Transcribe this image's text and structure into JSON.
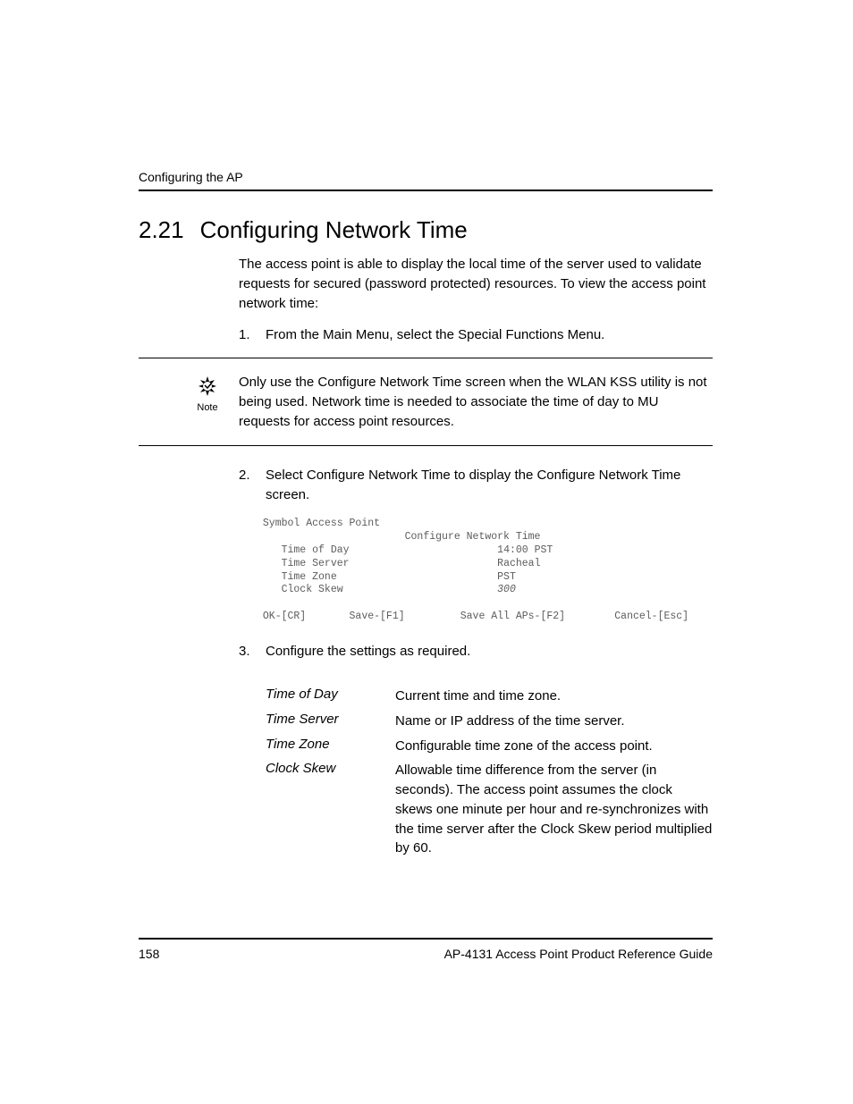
{
  "header": {
    "running_head": "Configuring the AP"
  },
  "section": {
    "number": "2.21",
    "title": "Configuring Network Time",
    "intro": "The access point is able to display the local time of the server used to validate requests for secured (password protected) resources. To view the access point network time:"
  },
  "steps": {
    "s1_marker": "1.",
    "s1_text": "From the Main Menu, select the Special Functions Menu.",
    "s2_marker": "2.",
    "s2_text": "Select Configure Network Time to display the Configure Network Time screen.",
    "s3_marker": "3.",
    "s3_text": "Configure the settings as required."
  },
  "note": {
    "label": "Note",
    "text": "Only use the Configure Network Time screen when the WLAN KSS utility is not being used. Network time is needed to associate the time of day to MU requests for access point resources."
  },
  "terminal": {
    "line1": " Symbol Access Point",
    "line2": "                        Configure Network Time",
    "line3_label": "    Time of Day",
    "line3_value": "14:00 PST",
    "line4_label": "    Time Server",
    "line4_value": "Racheal",
    "line5_label": "    Time Zone",
    "line5_value": "PST",
    "line6_label": "    Clock Skew",
    "line6_value": "300",
    "footer": " OK-[CR]       Save-[F1]         Save All APs-[F2]        Cancel-[Esc]"
  },
  "settings": {
    "time_of_day": {
      "label": "Time of Day",
      "desc": "Current time and time zone."
    },
    "time_server": {
      "label": "Time Server",
      "desc": "Name or IP address of the time server."
    },
    "time_zone": {
      "label": "Time Zone",
      "desc": "Configurable time zone of the access point."
    },
    "clock_skew": {
      "label": "Clock Skew",
      "desc": "Allowable time difference from the server (in seconds). The access point assumes the clock skews one minute per hour and re-synchronizes with the time server after the Clock Skew period multiplied by 60."
    }
  },
  "footer": {
    "page_num": "158",
    "doc_title": "AP-4131 Access Point Product Reference Guide"
  }
}
